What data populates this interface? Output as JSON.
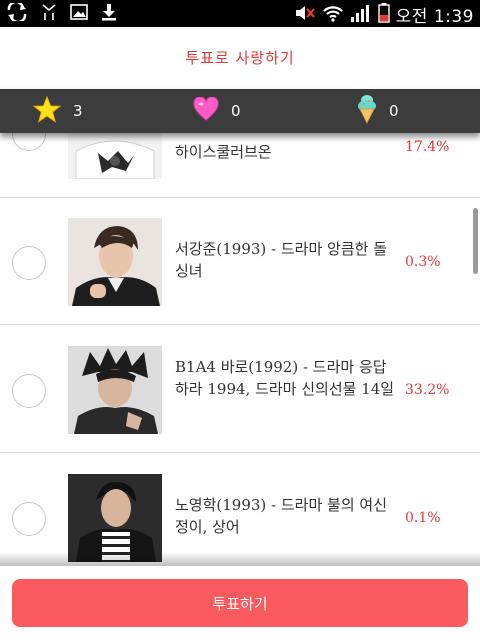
{
  "status_bar": {
    "time": "오전 1:39",
    "left_icons": [
      "sync-icon",
      "exo-icon",
      "image-icon",
      "download-icon"
    ],
    "right_icons": [
      "mute-icon",
      "wifi-icon",
      "signal-icon",
      "battery-icon"
    ]
  },
  "header": {
    "title": "투표로 사랑하기"
  },
  "stats": {
    "star_count": "3",
    "heart_count": "0",
    "icecream_count": "0"
  },
  "candidates": [
    {
      "name": "하이스쿨러브온",
      "percent": "17.4%"
    },
    {
      "name": "서강준(1993) - 드라마 앙큼한 돌싱녀",
      "percent": "0.3%"
    },
    {
      "name": "B1A4 바로(1992) - 드라마 응답하라 1994, 드라마 신의선물 14일",
      "percent": "33.2%"
    },
    {
      "name": "노영학(1993) - 드라마 불의 여신 정이, 상어",
      "percent": "0.1%"
    }
  ],
  "footer": {
    "vote_label": "투표하기"
  },
  "colors": {
    "accent": "#e53935",
    "button": "#f85a5e",
    "statsbar": "#3c3c3c"
  }
}
